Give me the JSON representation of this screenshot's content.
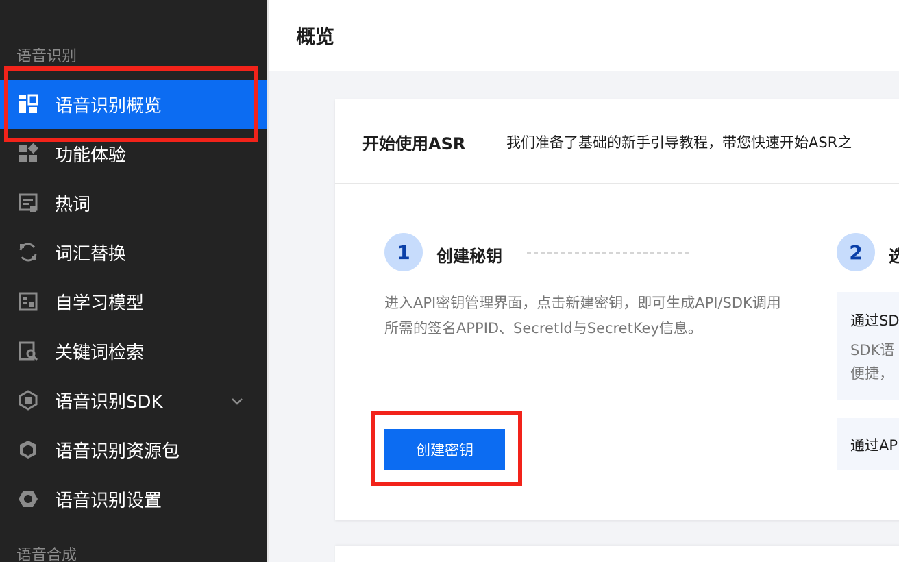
{
  "sidebar": {
    "group1": "语音识别",
    "group2": "语音合成",
    "items": [
      {
        "label": "语音识别概览",
        "icon": "dashboard-icon"
      },
      {
        "label": "功能体验",
        "icon": "apps-icon"
      },
      {
        "label": "热词",
        "icon": "hotword-icon"
      },
      {
        "label": "词汇替换",
        "icon": "replace-icon"
      },
      {
        "label": "自学习模型",
        "icon": "model-icon"
      },
      {
        "label": "关键词检索",
        "icon": "search-doc-icon"
      },
      {
        "label": "语音识别SDK",
        "icon": "sdk-icon"
      },
      {
        "label": "语音识别资源包",
        "icon": "package-icon"
      },
      {
        "label": "语音识别设置",
        "icon": "settings-hex-icon"
      }
    ]
  },
  "header": {
    "title": "概览"
  },
  "card": {
    "title": "开始使用ASR",
    "description": "我们准备了基础的新手引导教程，带您快速开始ASR之",
    "step1": {
      "number": "1",
      "title": "创建秘钥",
      "desc": "进入API密钥管理界面，点击新建密钥，即可生成API/SDK调用所需的签名APPID、SecretId与SecretKey信息。",
      "button": "创建密钥"
    },
    "step2": {
      "number": "2",
      "title": "选",
      "box1_title": "通过SD",
      "box1_line1": "SDK语",
      "box1_line2": "便捷，",
      "box2_title": "通过AP"
    }
  },
  "colors": {
    "accent": "#0c6cf2",
    "highlight": "#f2231a",
    "sidebar_bg": "#232323"
  }
}
